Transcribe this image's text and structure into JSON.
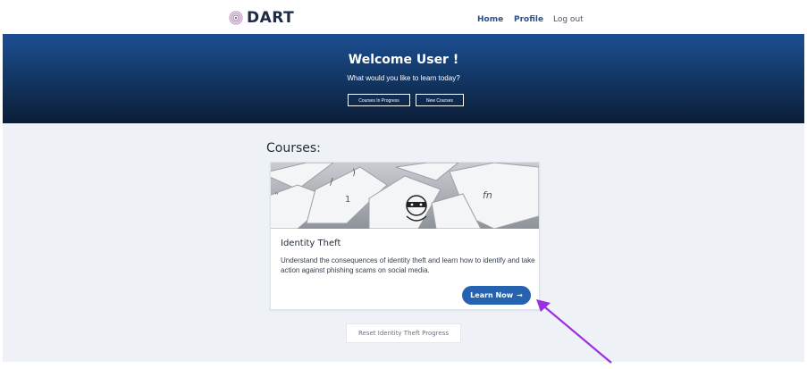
{
  "brand": {
    "name": "DART",
    "icon": "fingerprint-icon"
  },
  "nav": {
    "home": "Home",
    "profile": "Profile",
    "logout": "Log out"
  },
  "hero": {
    "title": "Welcome User !",
    "subtitle": "What would you like to learn today?",
    "btn_in_progress": "Courses In Progress",
    "btn_new": "New Courses"
  },
  "courses": {
    "heading": "Courses:",
    "items": [
      {
        "title": "Identity Theft",
        "description": "Understand the consequences of identity theft and learn how to identify and take action against phishing scams on social media.",
        "action_label": "Learn Now",
        "action_icon": "arrow-right-icon",
        "key_label": "fn"
      }
    ]
  },
  "reset_label": "Reset Identity Theft Progress",
  "colors": {
    "primary": "#2563b0",
    "hero_dark": "#0b1e38",
    "annotation": "#9b30e0"
  }
}
